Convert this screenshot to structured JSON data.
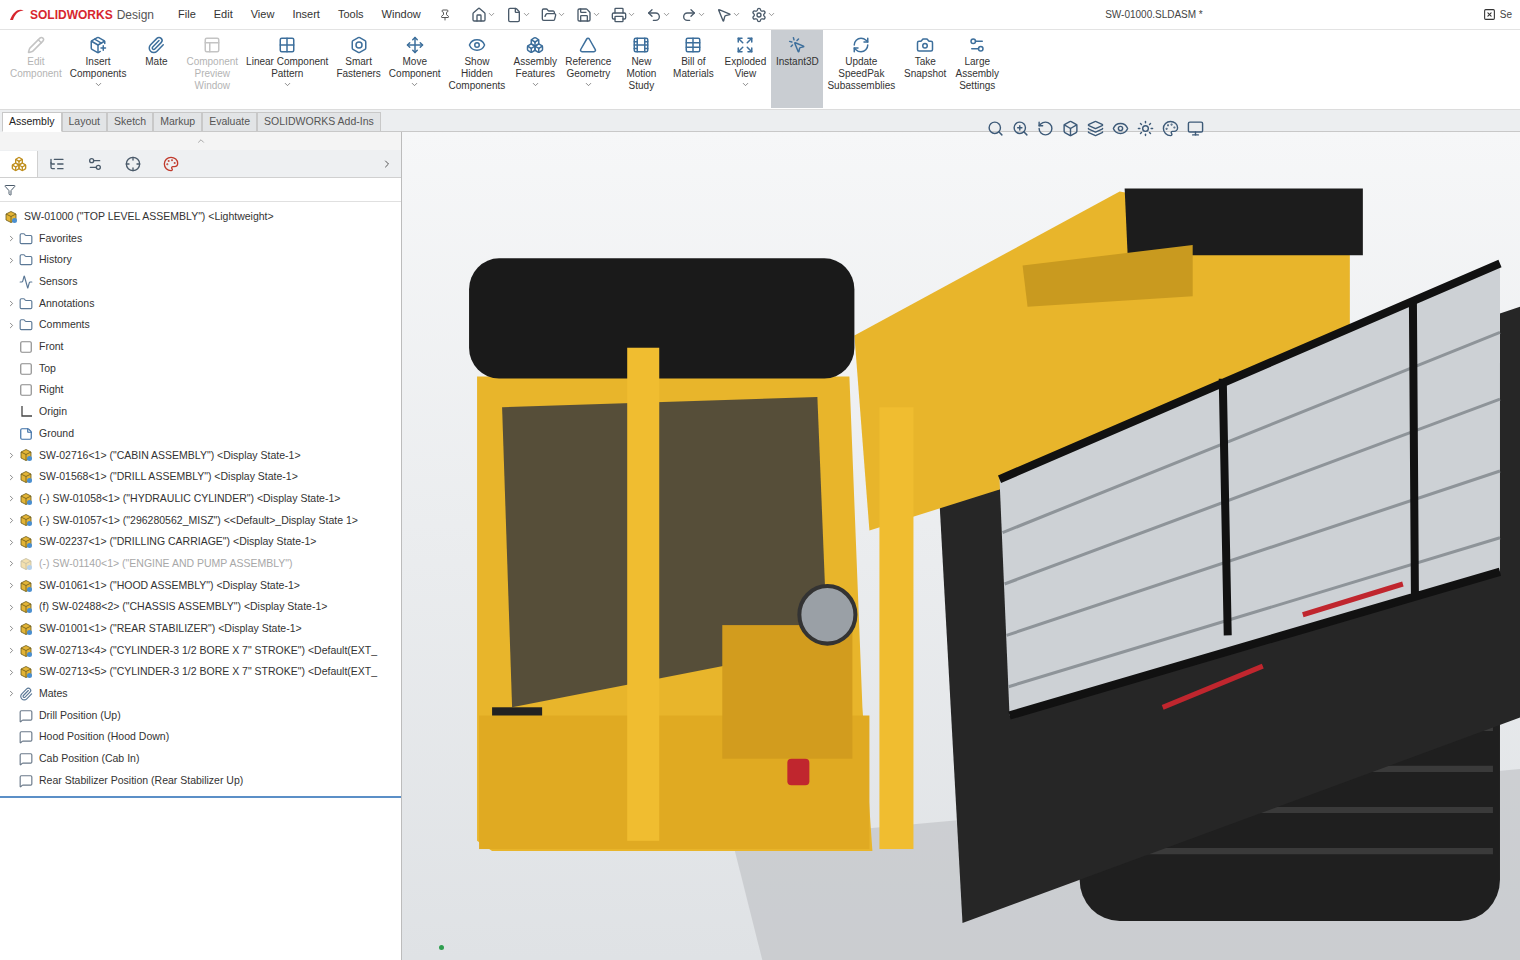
{
  "app": {
    "brand": "SOLIDWORKS",
    "product": "Design"
  },
  "menu": [
    "File",
    "Edit",
    "View",
    "Insert",
    "Tools",
    "Window"
  ],
  "window": {
    "title": "SW-01000.SLDASM *",
    "search": "Se"
  },
  "commands": [
    {
      "lines": [
        "Edit",
        "Component"
      ],
      "disabled": true,
      "dropdown": false,
      "selected": false
    },
    {
      "lines": [
        "Insert",
        "Components"
      ],
      "disabled": false,
      "dropdown": true,
      "selected": false
    },
    {
      "lines": [
        "Mate"
      ],
      "disabled": false,
      "dropdown": false,
      "selected": false
    },
    {
      "lines": [
        "Component",
        "Preview",
        "Window"
      ],
      "disabled": true,
      "dropdown": false,
      "selected": false
    },
    {
      "lines": [
        "Linear Component",
        "Pattern"
      ],
      "disabled": false,
      "dropdown": true,
      "selected": false
    },
    {
      "lines": [
        "Smart",
        "Fasteners"
      ],
      "disabled": false,
      "dropdown": false,
      "selected": false
    },
    {
      "lines": [
        "Move",
        "Component"
      ],
      "disabled": false,
      "dropdown": true,
      "selected": false
    },
    {
      "lines": [
        "Show",
        "Hidden",
        "Components"
      ],
      "disabled": false,
      "dropdown": false,
      "selected": false
    },
    {
      "lines": [
        "Assembly",
        "Features"
      ],
      "disabled": false,
      "dropdown": true,
      "selected": false
    },
    {
      "lines": [
        "Reference",
        "Geometry"
      ],
      "disabled": false,
      "dropdown": true,
      "selected": false
    },
    {
      "lines": [
        "New",
        "Motion",
        "Study"
      ],
      "disabled": false,
      "dropdown": false,
      "selected": false
    },
    {
      "lines": [
        "Bill of",
        "Materials"
      ],
      "disabled": false,
      "dropdown": false,
      "selected": false
    },
    {
      "lines": [
        "Exploded",
        "View"
      ],
      "disabled": false,
      "dropdown": true,
      "selected": false
    },
    {
      "lines": [
        "Instant3D"
      ],
      "disabled": false,
      "dropdown": false,
      "selected": true
    },
    {
      "lines": [
        "Update",
        "SpeedPak",
        "Subassemblies"
      ],
      "disabled": false,
      "dropdown": false,
      "selected": false
    },
    {
      "lines": [
        "Take",
        "Snapshot"
      ],
      "disabled": false,
      "dropdown": false,
      "selected": false
    },
    {
      "lines": [
        "Large",
        "Assembly",
        "Settings"
      ],
      "disabled": false,
      "dropdown": false,
      "selected": false
    }
  ],
  "tabs": [
    {
      "label": "Assembly",
      "selected": true
    },
    {
      "label": "Layout",
      "selected": false
    },
    {
      "label": "Sketch",
      "selected": false
    },
    {
      "label": "Markup",
      "selected": false
    },
    {
      "label": "Evaluate",
      "selected": false
    },
    {
      "label": "SOLIDWORKS Add-Ins",
      "selected": false
    }
  ],
  "tree": {
    "items": [
      {
        "label": "SW-01000 (\"TOP LEVEL ASSEMBLY\") <Lightweight>",
        "kind": "root",
        "depth": 0,
        "expandable": false,
        "suppressed": false
      },
      {
        "label": "Favorites",
        "kind": "folder",
        "depth": 1,
        "expandable": true,
        "suppressed": false
      },
      {
        "label": "History",
        "kind": "folder",
        "depth": 1,
        "expandable": true,
        "suppressed": false
      },
      {
        "label": "Sensors",
        "kind": "sensor",
        "depth": 1,
        "expandable": false,
        "suppressed": false
      },
      {
        "label": "Annotations",
        "kind": "folder",
        "depth": 1,
        "expandable": true,
        "suppressed": false
      },
      {
        "label": "Comments",
        "kind": "folder",
        "depth": 1,
        "expandable": true,
        "suppressed": false
      },
      {
        "label": "Front",
        "kind": "plane",
        "depth": 1,
        "expandable": false,
        "suppressed": false
      },
      {
        "label": "Top",
        "kind": "plane",
        "depth": 1,
        "expandable": false,
        "suppressed": false
      },
      {
        "label": "Right",
        "kind": "plane",
        "depth": 1,
        "expandable": false,
        "suppressed": false
      },
      {
        "label": "Origin",
        "kind": "origin",
        "depth": 1,
        "expandable": false,
        "suppressed": false
      },
      {
        "label": "Ground",
        "kind": "ground",
        "depth": 1,
        "expandable": false,
        "suppressed": false
      },
      {
        "label": "SW-02716<1> (\"CABIN ASSEMBLY\") <Display State-1>",
        "kind": "component",
        "depth": 1,
        "expandable": true,
        "suppressed": false
      },
      {
        "label": "SW-01568<1> (\"DRILL ASSEMBLY\") <Display State-1>",
        "kind": "component",
        "depth": 1,
        "expandable": true,
        "suppressed": false
      },
      {
        "label": "(-) SW-01058<1> (\"HYDRAULIC CYLINDER\") <Display State-1>",
        "kind": "component",
        "depth": 1,
        "expandable": true,
        "suppressed": false
      },
      {
        "label": "(-) SW-01057<1> (\"296280562_MISZ\") <<Default>_Display State 1>",
        "kind": "component",
        "depth": 1,
        "expandable": true,
        "suppressed": false
      },
      {
        "label": "SW-02237<1> (\"DRILLING CARRIAGE\") <Display State-1>",
        "kind": "component",
        "depth": 1,
        "expandable": true,
        "suppressed": false
      },
      {
        "label": "(-) SW-01140<1> (\"ENGINE AND PUMP ASSEMBLY\")",
        "kind": "component",
        "depth": 1,
        "expandable": true,
        "suppressed": true
      },
      {
        "label": "SW-01061<1> (\"HOOD ASSEMBLY\") <Display State-1>",
        "kind": "component",
        "depth": 1,
        "expandable": true,
        "suppressed": false
      },
      {
        "label": "(f) SW-02488<2> (\"CHASSIS ASSEMBLY\") <Display State-1>",
        "kind": "component",
        "depth": 1,
        "expandable": true,
        "suppressed": false
      },
      {
        "label": "SW-01001<1> (\"REAR STABILIZER\") <Display State-1>",
        "kind": "component",
        "depth": 1,
        "expandable": true,
        "suppressed": false
      },
      {
        "label": "SW-02713<4> (\"CYLINDER-3 1/2 BORE X 7\" STROKE\") <Default(EXT_",
        "kind": "component",
        "depth": 1,
        "expandable": true,
        "suppressed": false
      },
      {
        "label": "SW-02713<5> (\"CYLINDER-3 1/2 BORE X 7\" STROKE\") <Default(EXT_",
        "kind": "component",
        "depth": 1,
        "expandable": true,
        "suppressed": false
      },
      {
        "label": "Mates",
        "kind": "mates",
        "depth": 1,
        "expandable": true,
        "suppressed": false
      },
      {
        "label": "Drill Position (Up)",
        "kind": "position",
        "depth": 1,
        "expandable": false,
        "suppressed": false
      },
      {
        "label": "Hood Position (Hood Down)",
        "kind": "position",
        "depth": 1,
        "expandable": false,
        "suppressed": false
      },
      {
        "label": "Cab Position (Cab In)",
        "kind": "position",
        "depth": 1,
        "expandable": false,
        "suppressed": false
      },
      {
        "label": "Rear Stabilizer Position (Rear Stabilizer Up)",
        "kind": "position",
        "depth": 1,
        "expandable": false,
        "suppressed": false
      }
    ]
  }
}
